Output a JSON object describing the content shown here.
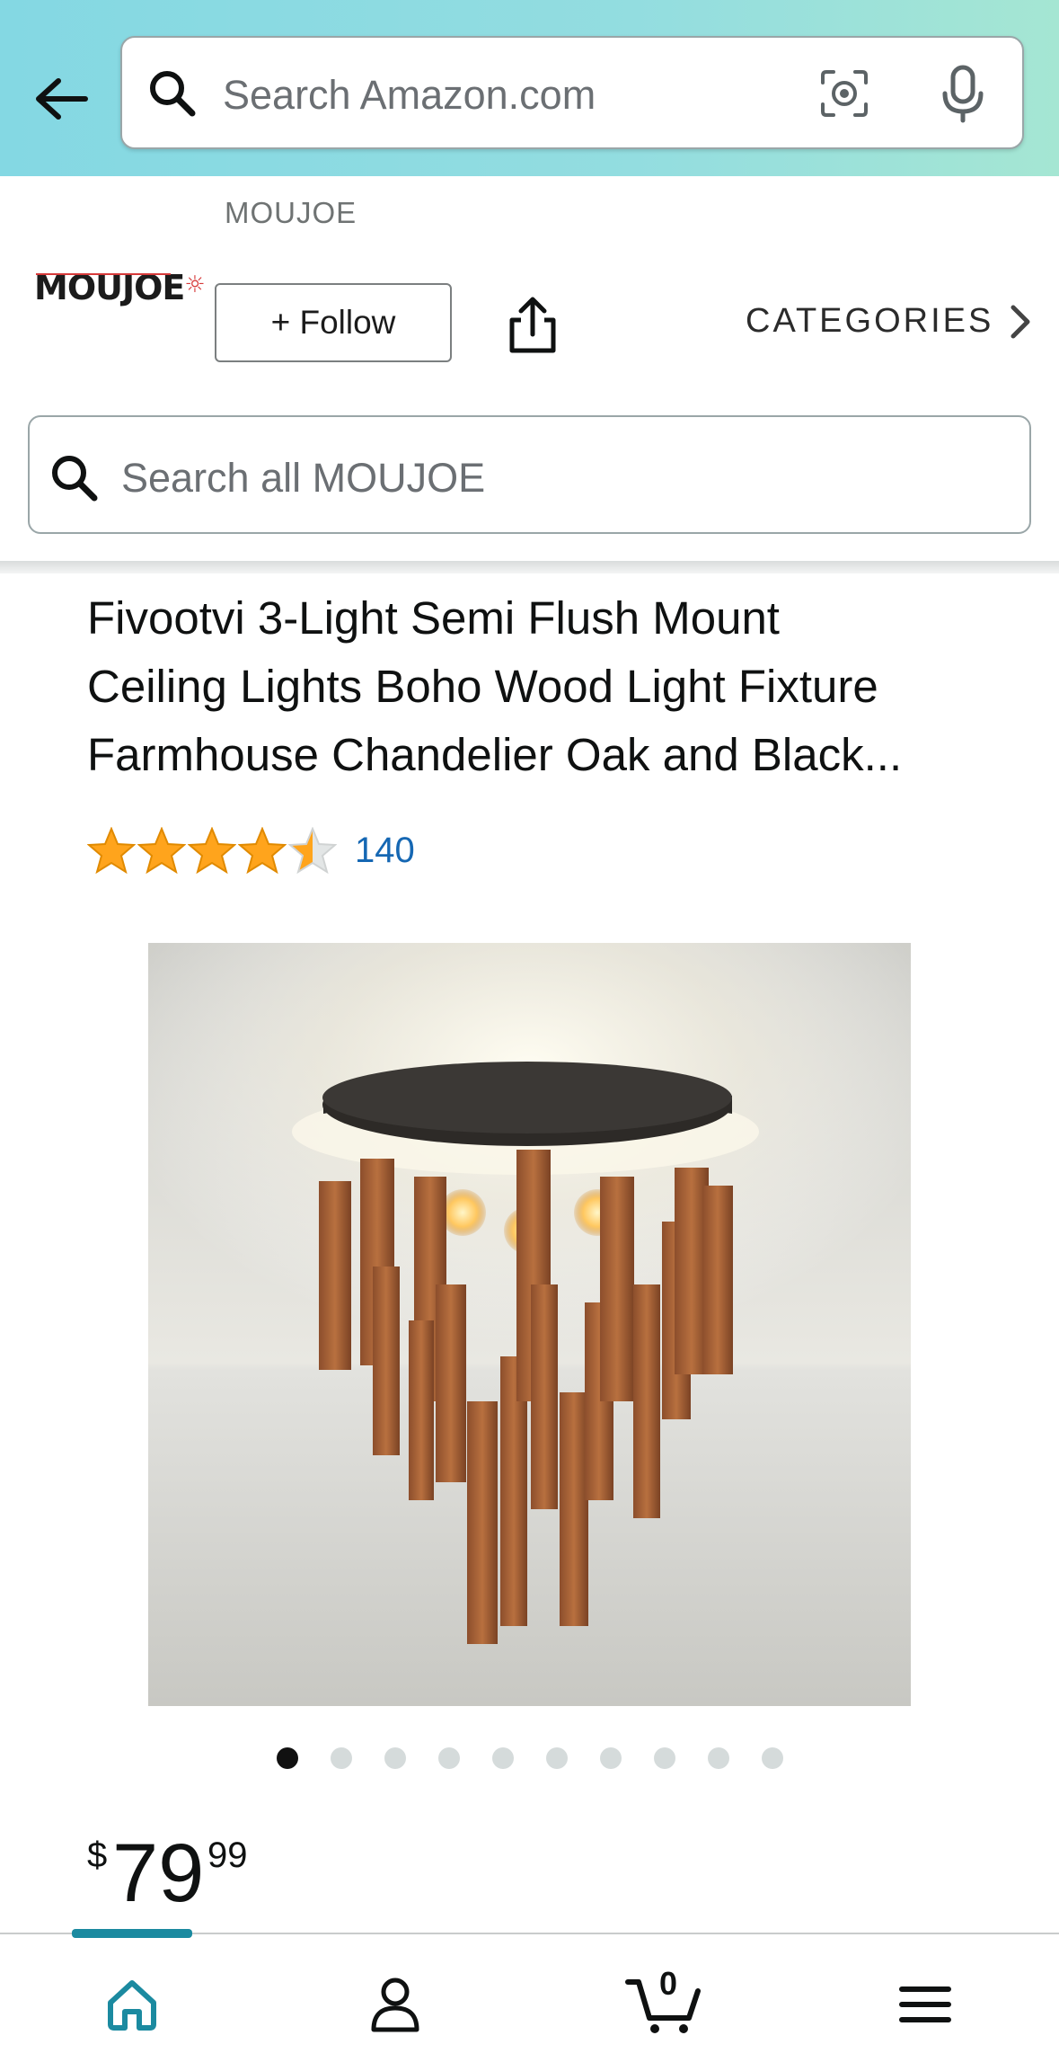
{
  "search": {
    "placeholder": "Search Amazon.com"
  },
  "store": {
    "brand_label": "MOUJOE",
    "logo_text": "MOUJOE",
    "follow_label": "+ Follow",
    "categories_label": "CATEGORIES",
    "search_placeholder": "Search all MOUJOE"
  },
  "product": {
    "title_lines": [
      "Fivootvi 3-Light Semi Flush Mount",
      "Ceiling Lights Boho Wood Light Fixture",
      "Farmhouse Chandelier Oak and Black..."
    ],
    "rating": 4.5,
    "rating_count": "140",
    "image_count": 10,
    "image_index": 1,
    "price": {
      "currency": "$",
      "whole": "79",
      "fraction": "99"
    }
  },
  "nav": {
    "items": [
      "home-icon",
      "account-icon",
      "cart-icon",
      "menu-icon"
    ],
    "cart_count": "0",
    "active": "home"
  },
  "colors": {
    "accent": "#1b8aa0",
    "link": "#1567b3",
    "star": "#ffa41c",
    "header_gradient_start": "#84d8e3",
    "header_gradient_end": "#a5e6d3"
  }
}
